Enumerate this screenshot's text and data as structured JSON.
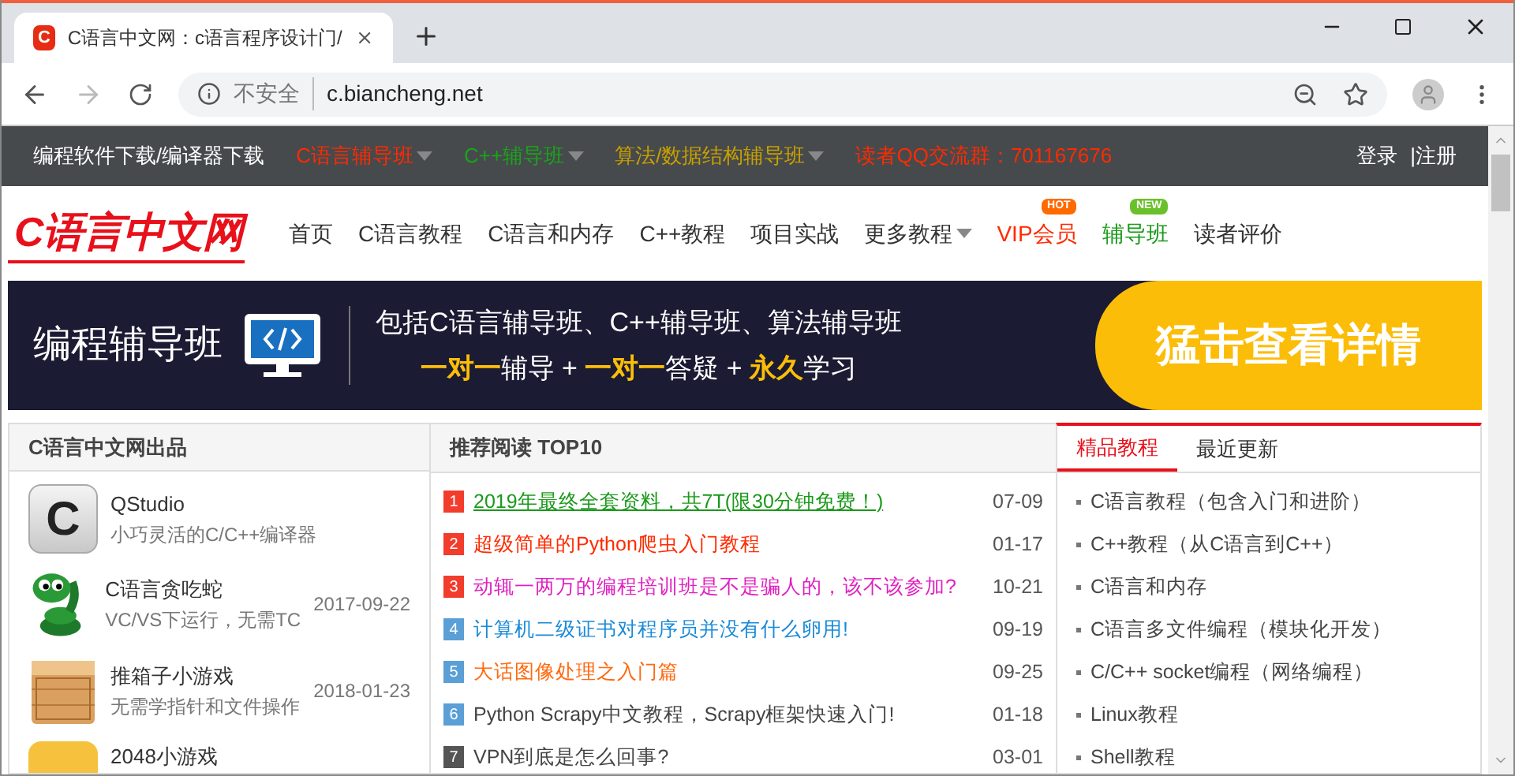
{
  "browser": {
    "tab_title": "C语言中文网：c语言程序设计门/",
    "favicon": "C",
    "security": "不安全",
    "url": "c.biancheng.net"
  },
  "topbar": {
    "links": [
      {
        "label": "编程软件下载/编译器下载",
        "color": "#ffffff",
        "has_menu": false
      },
      {
        "label": "C语言辅导班",
        "color": "#ff2a00",
        "has_menu": true
      },
      {
        "label": "C++辅导班",
        "color": "#1aa31a",
        "has_menu": true
      },
      {
        "label": "算法/数据结构辅导班",
        "color": "#c9a000",
        "has_menu": true
      },
      {
        "label": "读者QQ交流群：701167676",
        "color": "#ff2a00",
        "has_menu": false
      }
    ],
    "login": "登录",
    "register": "|注册"
  },
  "logo": "C语言中文网",
  "nav": [
    {
      "label": "首页",
      "color": "#333333",
      "has_menu": false
    },
    {
      "label": "C语言教程",
      "color": "#333333",
      "has_menu": false
    },
    {
      "label": "C语言和内存",
      "color": "#333333",
      "has_menu": false
    },
    {
      "label": "C++教程",
      "color": "#333333",
      "has_menu": false
    },
    {
      "label": "项目实战",
      "color": "#333333",
      "has_menu": false
    },
    {
      "label": "更多教程",
      "color": "#333333",
      "has_menu": true
    },
    {
      "label": "VIP会员",
      "color": "#ff2a00",
      "has_menu": false,
      "badge": {
        "text": "HOT",
        "color": "#ff6a00"
      }
    },
    {
      "label": "辅导班",
      "color": "#1a9a1a",
      "has_menu": false,
      "badge": {
        "text": "NEW",
        "color": "#6ac02a"
      }
    },
    {
      "label": "读者评价",
      "color": "#333333",
      "has_menu": false
    }
  ],
  "banner": {
    "title": "编程辅导班",
    "line1": "包括C语言辅导班、C++辅导班、算法辅导班",
    "line2": [
      {
        "text": "一对一",
        "highlight": true
      },
      {
        "text": "辅导 + ",
        "highlight": false
      },
      {
        "text": "一对一",
        "highlight": true
      },
      {
        "text": "答疑 + ",
        "highlight": false
      },
      {
        "text": "永久",
        "highlight": true
      },
      {
        "text": "学习",
        "highlight": false
      }
    ],
    "cta": "猛击查看详情"
  },
  "products": {
    "heading": "C语言中文网出品",
    "items": [
      {
        "kind": "letter",
        "letter": "C",
        "name": "QStudio",
        "desc": "小巧灵活的C/C++编译器"
      },
      {
        "kind": "snake",
        "name": "C语言贪吃蛇",
        "desc": "VC/VS下运行，无需TC",
        "date": "2017-09-22"
      },
      {
        "kind": "box",
        "name": "推箱子小游戏",
        "desc": "无需学指针和文件操作",
        "date": "2018-01-23"
      },
      {
        "kind": "tile",
        "name": "2048小游戏"
      }
    ]
  },
  "top10": {
    "heading": "推荐阅读 TOP10",
    "items": [
      {
        "rank": "1",
        "kind": "hot",
        "title": "2019年最终全套资料，共7T(限30分钟免费！)",
        "color": "#1a9a1a",
        "underline": true,
        "date": "07-09"
      },
      {
        "rank": "2",
        "kind": "hot",
        "title": "超级简单的Python爬虫入门教程",
        "color": "#ff2a00",
        "underline": false,
        "date": "01-17"
      },
      {
        "rank": "3",
        "kind": "hot",
        "title": "动辄一两万的编程培训班是不是骗人的，该不该参加?",
        "color": "#e020c0",
        "underline": false,
        "date": "10-21"
      },
      {
        "rank": "4",
        "kind": "warm",
        "title": "计算机二级证书对程序员并没有什么卵用!",
        "color": "#1a8ad8",
        "underline": false,
        "date": "09-19"
      },
      {
        "rank": "5",
        "kind": "warm",
        "title": "大话图像处理之入门篇",
        "color": "#ff6a10",
        "underline": false,
        "date": "09-25"
      },
      {
        "rank": "6",
        "kind": "warm",
        "title": "Python Scrapy中文教程，Scrapy框架快速入门!",
        "color": "#444444",
        "underline": false,
        "date": "01-18"
      },
      {
        "rank": "7",
        "kind": "plain",
        "title": "VPN到底是怎么回事?",
        "color": "#444444",
        "underline": false,
        "date": "03-01"
      }
    ]
  },
  "tutorials": {
    "tabs": [
      {
        "label": "精品教程",
        "selected": true
      },
      {
        "label": "最近更新",
        "selected": false
      }
    ],
    "items": [
      "C语言教程（包含入门和进阶）",
      "C++教程（从C语言到C++）",
      "C语言和内存",
      "C语言多文件编程（模块化开发）",
      "C/C++ socket编程（网络编程）",
      "Linux教程",
      "Shell教程"
    ]
  }
}
